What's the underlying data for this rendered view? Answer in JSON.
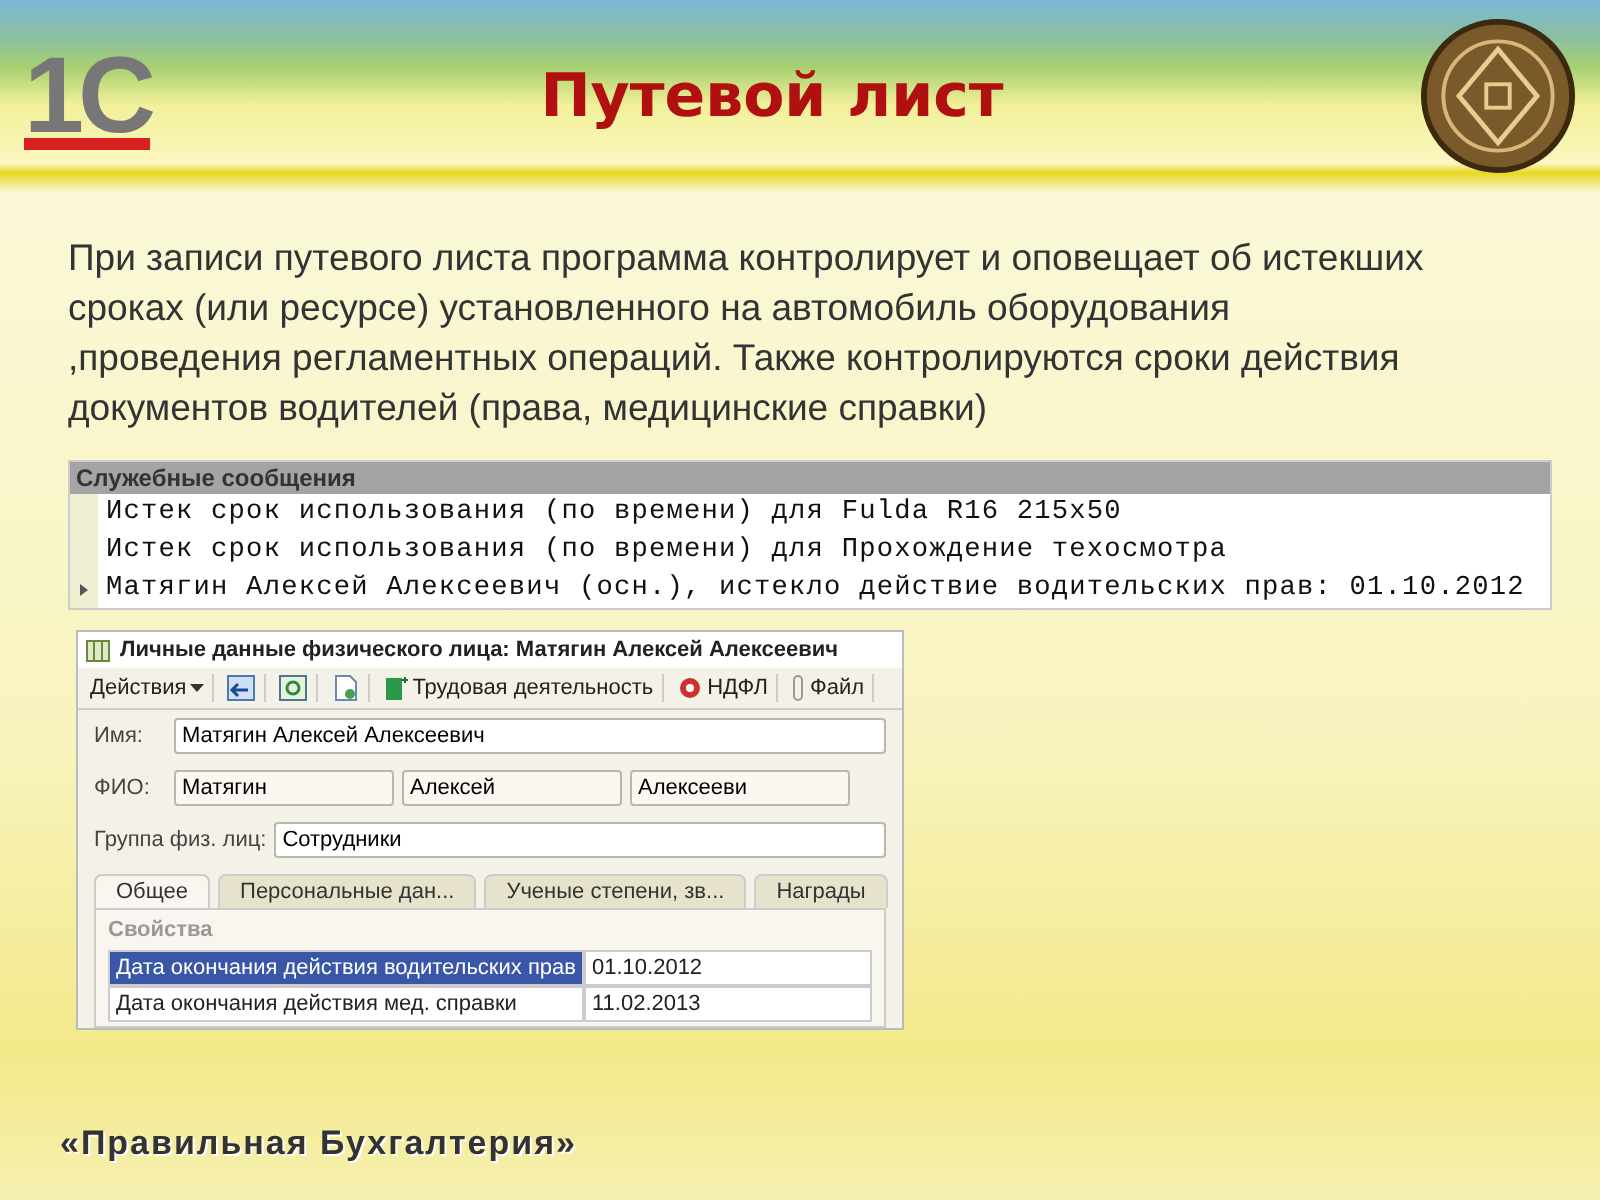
{
  "logo": {
    "text": "1С"
  },
  "title": "Путевой лист",
  "paragraph": "При записи путевого листа программа контролирует и оповещает об истекших сроках (или ресурсе) установленного на автомобиль оборудования ,проведения регламентных операций. Также контролируются сроки действия документов водителей (права, медицинские справки)",
  "messages": {
    "title": "Служебные сообщения",
    "rows": [
      {
        "text": "Истек срок использования (по времени) для Fulda R16 215x50",
        "current": false
      },
      {
        "text": "Истек срок использования (по времени) для Прохождение техосмотра",
        "current": false
      },
      {
        "text": "Матягин Алексей Алексеевич (осн.), истекло действие водительских прав: 01.10.2012",
        "current": true
      }
    ]
  },
  "form": {
    "title": "Личные данные физического лица: Матягин Алексей Алексеевич",
    "toolbar": [
      {
        "kind": "menu",
        "label": "Действия"
      },
      {
        "kind": "icon"
      },
      {
        "kind": "icon"
      },
      {
        "kind": "icon"
      },
      {
        "kind": "icon",
        "label": "Трудовая деятельность"
      },
      {
        "kind": "icon",
        "label": "НДФЛ"
      },
      {
        "kind": "icon",
        "label": "Файл"
      }
    ],
    "name": {
      "label": "Имя:",
      "value": "Матягин Алексей Алексеевич"
    },
    "fio": {
      "label": "ФИО:",
      "values": [
        "Матягин",
        "Алексей",
        "Алексееви"
      ]
    },
    "group": {
      "label": "Группа физ. лиц:",
      "value": "Сотрудники"
    },
    "tabs": [
      {
        "label": "Общее",
        "selected": true
      },
      {
        "label": "Персональные дан...",
        "selected": false
      },
      {
        "label": "Ученые степени, зв...",
        "selected": false
      },
      {
        "label": "Награды",
        "selected": false
      }
    ],
    "section": "Свойства",
    "properties": [
      {
        "name": "Дата окончания действия водительских прав",
        "value": "01.10.2012",
        "selected": true
      },
      {
        "name": "Дата окончания действия мед. справки",
        "value": "11.02.2013",
        "selected": false
      }
    ]
  },
  "footer": "«Правильная Бухгалтерия»"
}
